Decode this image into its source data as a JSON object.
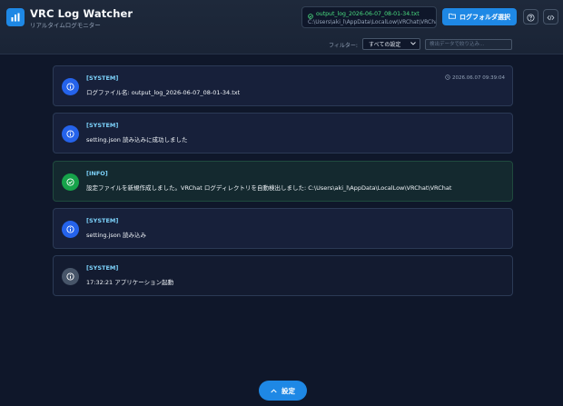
{
  "app": {
    "title": "VRC Log Watcher",
    "subtitle": "リアルタイムログモニター"
  },
  "file": {
    "name": "output_log_2026-06-07_08-01-34.txt",
    "path": "C:\\Users\\aki_l\\AppData\\LocalLow\\VRChat\\VRChat"
  },
  "toolbar": {
    "folder_button_label": "ログフォルダ選択",
    "help_icon": "question-circle-icon",
    "code_icon": "code-icon"
  },
  "filter": {
    "label": "フィルター:",
    "selected": "すべての設定",
    "search_placeholder": "検出データで絞り込み..."
  },
  "logs": [
    {
      "level": "system",
      "tag": "[SYSTEM]",
      "message": "ログファイル名: output_log_2026-06-07_08-01-34.txt",
      "time": "2026.06.07 09:39:04"
    },
    {
      "level": "system",
      "tag": "[SYSTEM]",
      "message": "setting.json 読み込みに成功しました",
      "time": ""
    },
    {
      "level": "info",
      "tag": "[INFO]",
      "message": "設定ファイルを新規作成しました。VRChat ログディレクトリを自動検出しました: C:\\Users\\aki_l\\AppData\\LocalLow\\VRChat\\VRChat",
      "time": ""
    },
    {
      "level": "system",
      "tag": "[SYSTEM]",
      "message": "setting.json 読み込み",
      "time": ""
    },
    {
      "level": "system-muted",
      "tag": "[SYSTEM]",
      "message": "17:32:21 アプリケーション起動",
      "time": ""
    }
  ],
  "footer": {
    "settings_label": "設定"
  },
  "colors": {
    "accent": "#1e88e5",
    "system_icon": "#2563eb",
    "info_icon": "#16a34a",
    "muted_icon": "#475569",
    "file_name": "#4ade80",
    "tag": "#7dd3fc"
  }
}
